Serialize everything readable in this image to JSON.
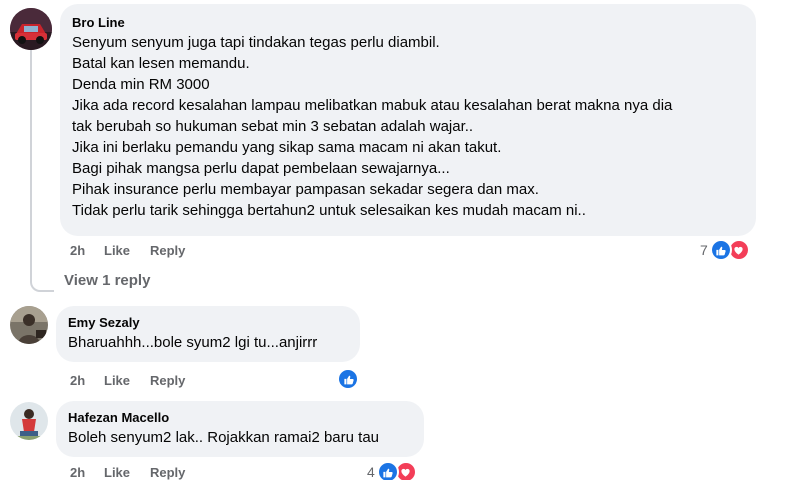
{
  "comments": [
    {
      "author": "Bro Line",
      "lines": [
        "Senyum senyum juga tapi tindakan tegas perlu diambil.",
        "Batal kan lesen memandu.",
        "Denda min RM 3000",
        "Jika ada record kesalahan lampau melibatkan mabuk atau kesalahan berat makna nya dia",
        "tak berubah so hukuman sebat min 3 sebatan adalah wajar..",
        "Jika ini berlaku pemandu yang sikap sama macam ni akan takut.",
        "Bagi pihak mangsa perlu dapat pembelaan sewajarnya...",
        "Pihak insurance perlu membayar pampasan sekadar segera dan max.",
        "Tidak perlu tarik sehingga bertahun2 untuk selesaikan kes mudah macam ni.."
      ],
      "time": "2h",
      "like_label": "Like",
      "reply_label": "Reply",
      "reaction_count": "7",
      "reactions": [
        "like-icon",
        "love-icon"
      ]
    },
    {
      "author": "Emy Sezaly",
      "lines": [
        "Bharuahhh...bole syum2 lgi tu...anjirrr"
      ],
      "time": "2h",
      "like_label": "Like",
      "reply_label": "Reply",
      "reaction_count": "",
      "reactions": [
        "like-icon"
      ]
    },
    {
      "author": "Hafezan Macello",
      "lines": [
        "Boleh senyum2 lak.. Rojakkan ramai2 baru tau"
      ],
      "time": "2h",
      "like_label": "Like",
      "reply_label": "Reply",
      "reaction_count": "4",
      "reactions": [
        "like-icon",
        "love-icon"
      ]
    }
  ],
  "view_replies_label": "View 1 reply",
  "colors": {
    "bubble": "#f0f2f5",
    "meta": "#65676b",
    "like": "#1b74e4",
    "love": "#f33e58"
  }
}
